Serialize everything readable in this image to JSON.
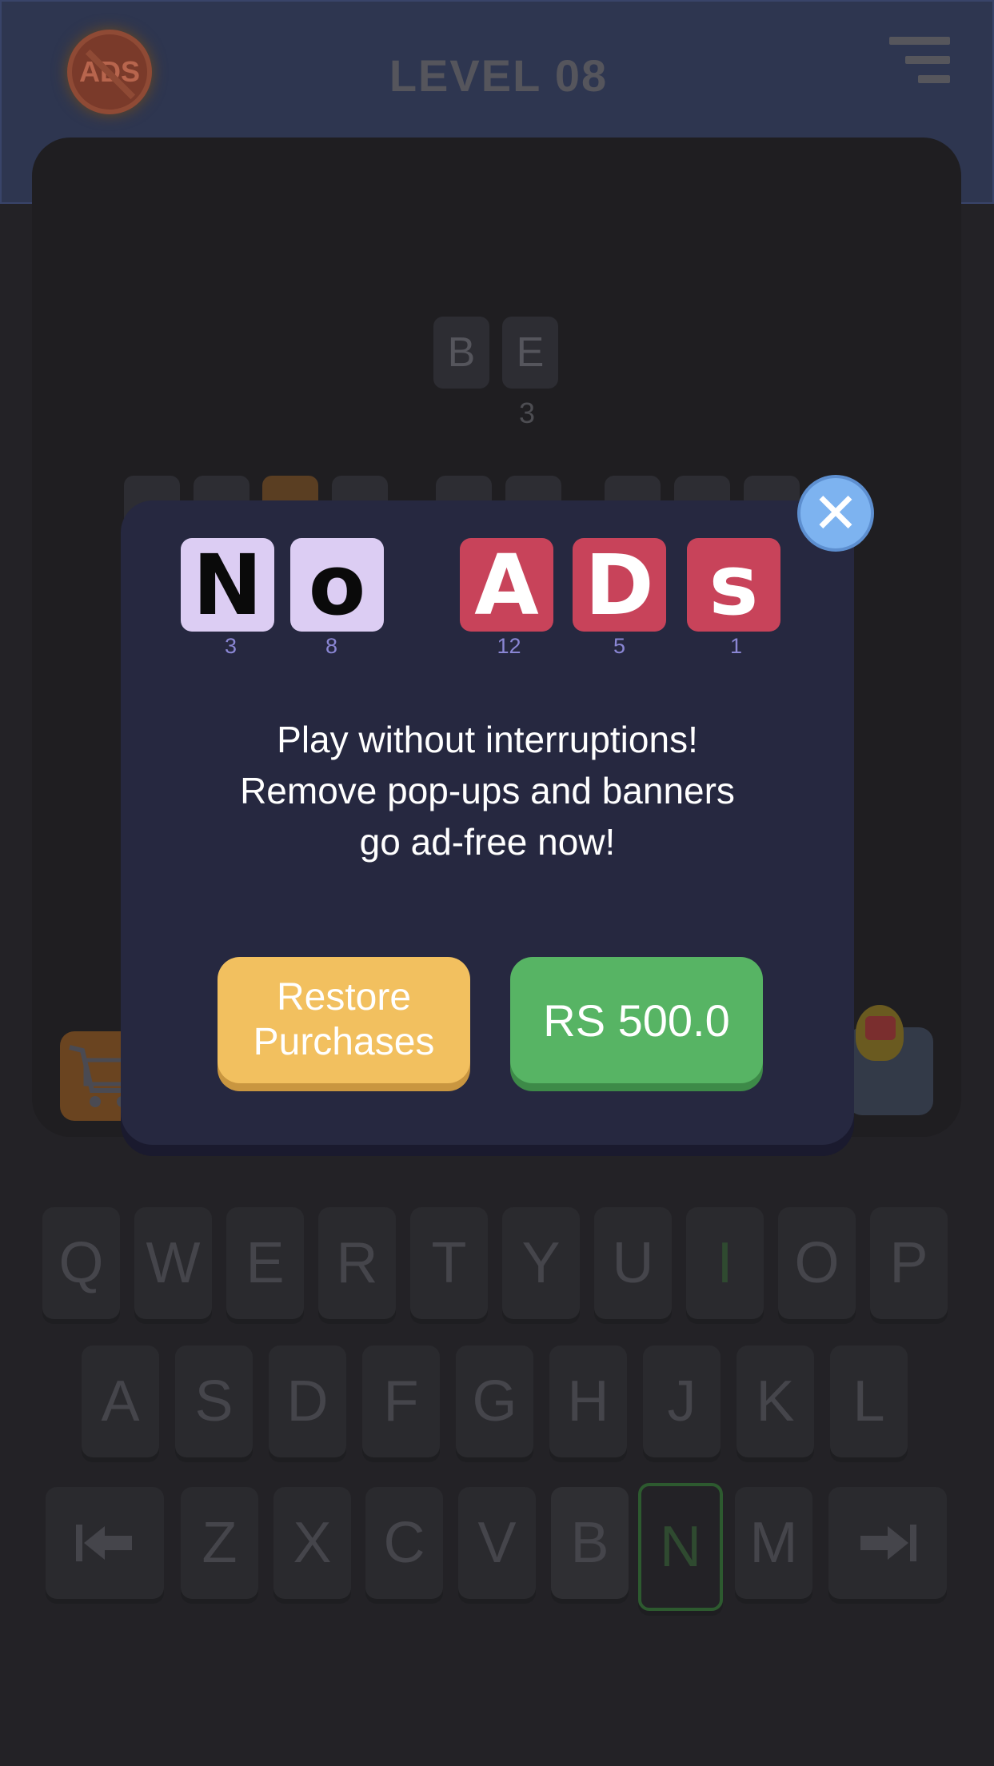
{
  "header": {
    "no_ads_badge": "ADS",
    "level_title": "LEVEL 08"
  },
  "board": {
    "clue_tiles": [
      "B",
      "E"
    ],
    "clue_number": "3"
  },
  "keyboard": {
    "row1": [
      "Q",
      "W",
      "E",
      "R",
      "T",
      "Y",
      "U",
      "I",
      "O",
      "P"
    ],
    "row2": [
      "A",
      "S",
      "D",
      "F",
      "G",
      "H",
      "J",
      "K",
      "L"
    ],
    "row3": [
      "Z",
      "X",
      "C",
      "V",
      "B",
      "N",
      "M"
    ]
  },
  "modal": {
    "close_symbol": "✕",
    "title_tiles": [
      {
        "letter": "N",
        "number": "3"
      },
      {
        "letter": "o",
        "number": "8"
      },
      {
        "letter": "A",
        "number": "12"
      },
      {
        "letter": "D",
        "number": "5"
      },
      {
        "letter": "s",
        "number": "1"
      }
    ],
    "promo_lines": [
      "Play without interruptions!",
      "Remove pop-ups and banners",
      "go ad-free now!"
    ],
    "restore_label_line1": "Restore",
    "restore_label_line2": "Purchases",
    "buy_label": "RS 500.0"
  },
  "colors": {
    "modal_bg": "#262840",
    "tile_lilac": "#dccdf3",
    "tile_red": "#c8435a",
    "restore_yellow": "#f2c05f",
    "buy_green": "#57b464",
    "close_blue": "#7db3f0"
  }
}
